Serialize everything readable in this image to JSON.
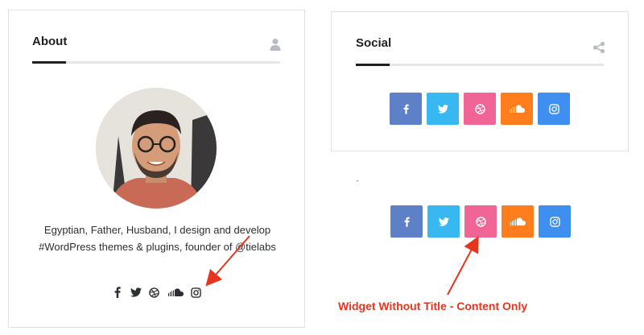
{
  "about_widget": {
    "title": "About",
    "title_icon": "user-icon",
    "bio": "Egyptian, Father, Husband, I design and develop #WordPress themes & plugins, founder of @tielabs",
    "social_icons": [
      "facebook-icon",
      "twitter-icon",
      "dribbble-icon",
      "soundcloud-icon",
      "instagram-icon"
    ]
  },
  "social_widget": {
    "title": "Social",
    "title_icon": "share-icon",
    "buttons": [
      {
        "name": "facebook",
        "color": "#5d80c7"
      },
      {
        "name": "twitter",
        "color": "#38b8f0"
      },
      {
        "name": "dribbble",
        "color": "#f06496"
      },
      {
        "name": "soundcloud",
        "color": "#ff7d1d"
      },
      {
        "name": "instagram",
        "color": "#3f8ff1"
      }
    ]
  },
  "annotation": {
    "text": "Widget Without Title - Content Only",
    "color": "#e8341c"
  }
}
